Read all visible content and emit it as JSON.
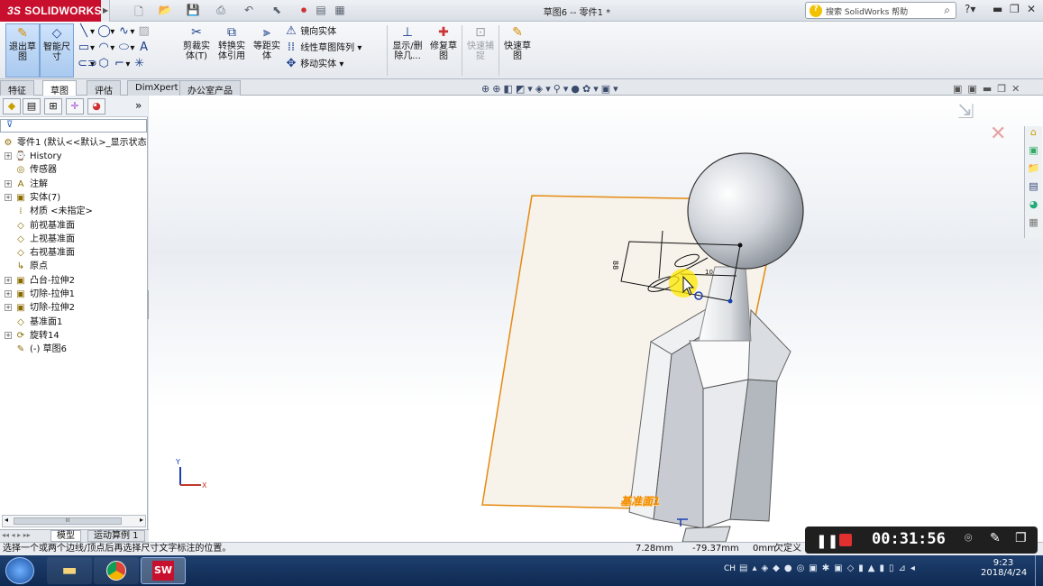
{
  "app": {
    "logo_text": "SOLIDWORKS",
    "logo_prefix": "3S",
    "doc_title": "草图6 -- 零件1 *",
    "help_search_placeholder": "搜索 SolidWorks 帮助"
  },
  "ribbon": {
    "exit_sketch": "退出草图",
    "smart_dim": "智能尺寸",
    "trim": "剪裁实体(T)",
    "convert": "转换实体引用",
    "offset": "等距实体",
    "mirror": "镜向实体",
    "linear_pattern": "线性草图阵列",
    "move": "移动实体",
    "show_delete": "显示/删除几...",
    "repair": "修复草图",
    "quick_snap": "快速捕捉",
    "quick_sketch": "快速草图"
  },
  "tabs": [
    "特征",
    "草图",
    "评估",
    "DimXpert",
    "办公室产品"
  ],
  "selected_tab": "草图",
  "tree": {
    "root": "零件1 (默认<<默认>_显示状态",
    "items": [
      {
        "label": "History",
        "icon": "history-icon",
        "expand": true
      },
      {
        "label": "传感器",
        "icon": "sensor-icon",
        "expand": false
      },
      {
        "label": "注解",
        "icon": "annotation-icon",
        "expand": true
      },
      {
        "label": "实体(7)",
        "icon": "solid-bodies-icon",
        "expand": true
      },
      {
        "label": "材质 <未指定>",
        "icon": "material-icon",
        "expand": false
      },
      {
        "label": "前视基准面",
        "icon": "plane-icon",
        "expand": false
      },
      {
        "label": "上视基准面",
        "icon": "plane-icon",
        "expand": false
      },
      {
        "label": "右视基准面",
        "icon": "plane-icon",
        "expand": false
      },
      {
        "label": "原点",
        "icon": "origin-icon",
        "expand": false
      },
      {
        "label": "凸台-拉伸2",
        "icon": "boss-extrude-icon",
        "expand": true
      },
      {
        "label": "切除-拉伸1",
        "icon": "cut-extrude-icon",
        "expand": true
      },
      {
        "label": "切除-拉伸2",
        "icon": "cut-extrude-icon",
        "expand": true
      },
      {
        "label": "基准面1",
        "icon": "plane-icon",
        "expand": false
      },
      {
        "label": "旋转14",
        "icon": "revolve-icon",
        "expand": true
      },
      {
        "label": "(-) 草图6",
        "icon": "sketch-icon",
        "expand": false
      }
    ]
  },
  "bottom_tabs": [
    "模型",
    "运动算例 1"
  ],
  "viewport": {
    "plane_label": "基准面1"
  },
  "status": {
    "message": "选择一个或两个边线/顶点后再选择尺寸文字标注的位置。",
    "x": "7.28mm",
    "y": "-79.37mm",
    "z": "0mm",
    "state": "欠定义"
  },
  "recorder": {
    "time": "00:31:56"
  },
  "taskbar": {
    "lang": "CH",
    "time": "9:23",
    "date": "2018/4/24"
  }
}
